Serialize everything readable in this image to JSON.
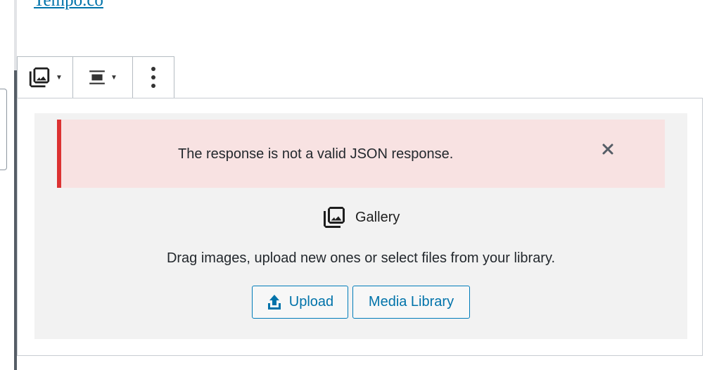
{
  "link": {
    "text": "Tempo.co"
  },
  "toolbar": {
    "block_type_icon": "gallery-icon",
    "align_icon": "align-center-icon",
    "more_icon": "more-vertical-icon"
  },
  "notice": {
    "message": "The response is not a valid JSON response.",
    "close_icon": "close-icon"
  },
  "gallery": {
    "label": "Gallery",
    "instructions": "Drag images, upload new ones or select files from your library.",
    "upload_label": "Upload",
    "media_library_label": "Media Library"
  },
  "colors": {
    "accent": "#0073aa",
    "error": "#dc3232",
    "notice_bg": "#f8e2e2"
  }
}
